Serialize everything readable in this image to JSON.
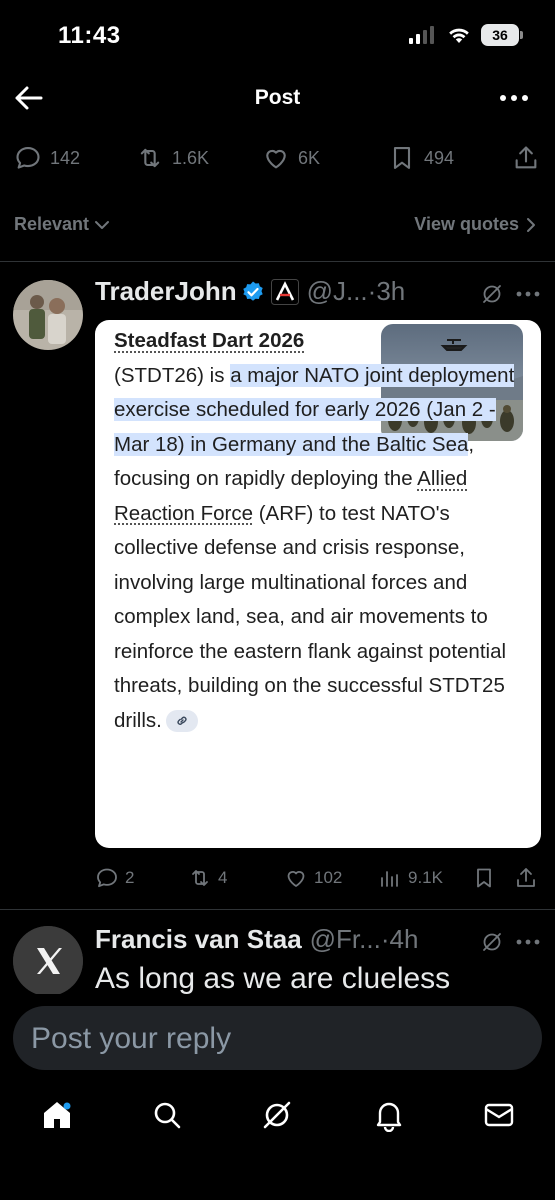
{
  "status_bar": {
    "time": "11:43",
    "battery": "36",
    "signal_icon": "cellular-signal-icon",
    "wifi_icon": "wifi-icon"
  },
  "header": {
    "title": "Post",
    "back_icon": "arrow-left-icon",
    "more_icon": "more-horizontal-icon"
  },
  "stats": {
    "replies": "142",
    "reposts": "1.6K",
    "likes": "6K",
    "bookmarks": "494"
  },
  "sort": {
    "relevant_label": "Relevant",
    "view_quotes_label": "View quotes"
  },
  "reply_1": {
    "name": "TraderJohn",
    "handle": "@J...",
    "time": "·3h",
    "card": {
      "title": "Steadfast Dart 2026",
      "text_part1": "(STDT26) is ",
      "highlight": "a major NATO joint deployment exercise scheduled for early 2026 (Jan 2 - Mar 18) in Germany and the Baltic Sea",
      "text_part2": ", focusing on rapidly deploying the ",
      "link_text": "Allied Reaction Force",
      "text_part3": " (ARF) to test NATO's collective defense and crisis response, involving large multinational forces and complex land, sea, and air movements to reinforce the eastern flank against potential threats, building on the successful STDT25 drills."
    },
    "actions": {
      "replies": "2",
      "reposts": "4",
      "likes": "102",
      "views": "9.1K"
    }
  },
  "reply_2": {
    "name": "Francis van Staa",
    "handle": "@Fr...",
    "time": "·4h",
    "text": "As long as we are clueless"
  },
  "composer": {
    "placeholder": "Post your reply"
  },
  "colors": {
    "background": "#000000",
    "text": "#e7e9ea",
    "muted": "#71767b",
    "verified": "#1d9bf0",
    "highlight": "#d3e3fd"
  }
}
